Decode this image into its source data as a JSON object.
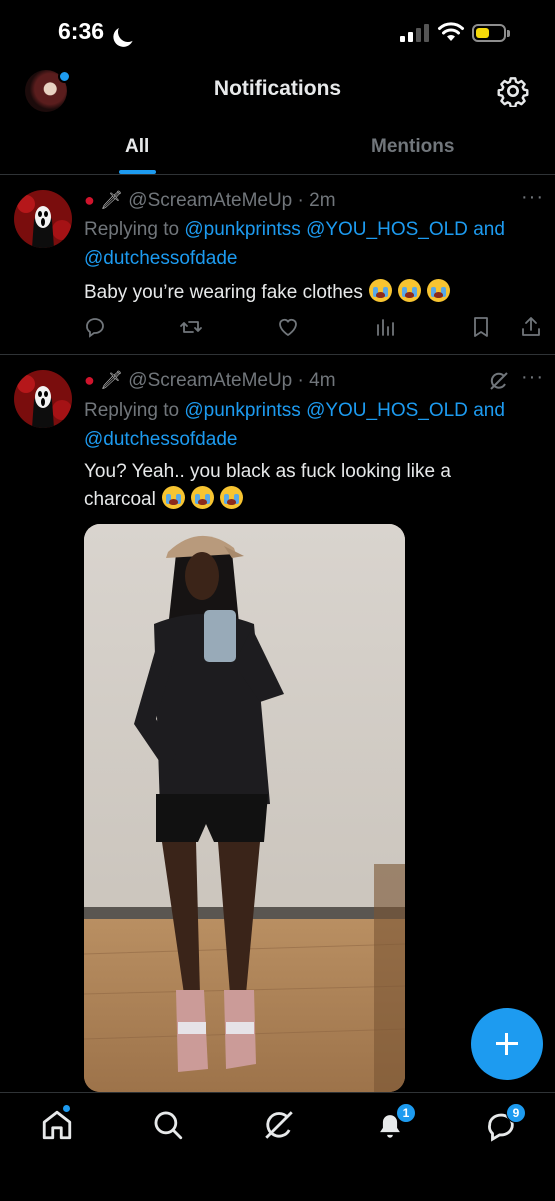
{
  "status_bar": {
    "time": "6:36"
  },
  "header": {
    "title": "Notifications"
  },
  "tabs": [
    {
      "label": "All",
      "active": true
    },
    {
      "label": "Mentions",
      "active": false
    }
  ],
  "tweets": [
    {
      "handle": "@ScreamAteMeUp",
      "time": "2m",
      "replying_prefix": "Replying to",
      "mentions_line1": "@punkprintss @YOU_HOS_OLD",
      "and": "and",
      "mention_line2": "@dutchessofdade",
      "text": "Baby you’re wearing fake clothes",
      "emoji": "crying-face x3"
    },
    {
      "handle": "@ScreamAteMeUp",
      "time": "4m",
      "replying_prefix": "Replying to",
      "mentions_line1": "@punkprintss @YOU_HOS_OLD",
      "and": "and",
      "mention_line2": "@dutchessofdade",
      "text_line1": "You? Yeah.. you black as fuck looking like a",
      "text_line2": "charcoal",
      "emoji": "crying-face x3"
    }
  ],
  "nav": {
    "notifications_badge": "1",
    "messages_badge": "9"
  },
  "colors": {
    "accent": "#1d9bf0",
    "background": "#000000",
    "muted": "#71767b"
  },
  "icons": [
    "moon-icon",
    "signal-icon",
    "wifi-icon",
    "battery-icon",
    "gear-icon",
    "reply-icon",
    "retweet-icon",
    "like-icon",
    "views-icon",
    "bookmark-icon",
    "share-icon",
    "grok-icon",
    "more-icon",
    "plus-icon",
    "home-icon",
    "search-icon",
    "bell-icon",
    "messages-icon"
  ]
}
